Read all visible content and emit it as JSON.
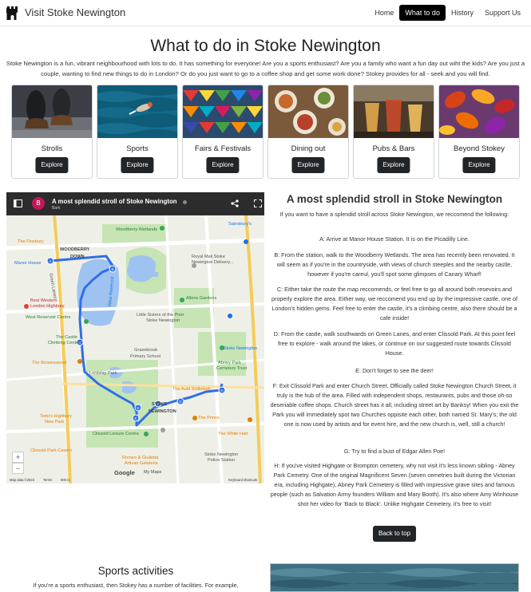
{
  "nav": {
    "brand": "Visit Stoke Newington",
    "links": [
      "Home",
      "What to do",
      "History",
      "Support Us"
    ]
  },
  "header": {
    "title": "What to do in Stoke Newington",
    "intro": "Stoke Newington is a fun, vibrant neighbourhood with lots to do. It has something for everyone! Are you a sports enthusiast? Are you a family who want a fun day out wiht the kids? Are you just a couple, wanting to find new things to do in London? Or do you just want to go to a coffee shop and get some work done? Stokey provides for all - seek and you will find."
  },
  "cards": [
    {
      "title": "Strolls",
      "button": "Explore",
      "image": "boots-walking-photo"
    },
    {
      "title": "Sports",
      "button": "Explore",
      "image": "swimmer-photo"
    },
    {
      "title": "Fairs & Festivals",
      "button": "Explore",
      "image": "bunting-photo"
    },
    {
      "title": "Dining out",
      "button": "Explore",
      "image": "food-table-photo"
    },
    {
      "title": "Pubs & Bars",
      "button": "Explore",
      "image": "cocktails-photo"
    },
    {
      "title": "Beyond Stokey",
      "button": "Explore",
      "image": "autumn-leaves-photo"
    }
  ],
  "map": {
    "avatar": "B",
    "title": "A most splendid stroll of Stoke Newington",
    "subtitle": "Bark",
    "labels": {
      "woodberry_wetlands": "Woodberry Wetlands",
      "sainsburys": "Sainsbury's",
      "woodberry_down_1": "WOODBERRY",
      "woodberry_down_2": "DOWN",
      "royal_mail": "Royal Mail Stoke",
      "royal_mail_2": "Newington Delivery...",
      "manor_house": "Manor House",
      "finsbury": "The Finsbury",
      "west_reservoir": "West Reservoir",
      "best_western_1": "Best Western",
      "best_western_2": "London Highbury",
      "allens_gardens": "Allens Gardens",
      "little_sisters_1": "Little Sisters of the Poor",
      "little_sisters_2": "Stoke Newington",
      "west_reservoir_centre": "West Reservoir Centre",
      "castle_1": "The Castle",
      "castle_2": "Climbing Centre",
      "grazebrook_1": "Grazebrook",
      "grazebrook_2": "Primary School",
      "stoke_newington": "Stoke Newington",
      "abney_1": "Abney Park",
      "abney_2": "Cemetery Trust",
      "brownswood": "The Brownswood",
      "lordship": "Lordship Park",
      "auld_shillelagh": "The Auld Shillelagh",
      "stoke_n_1": "STOKE",
      "stoke_n_2": "NEWINGTON",
      "tettos_1": "Tetto's Highbury",
      "tettos_2": "New Park",
      "prince": "The Prince",
      "white_hart": "The White Hart",
      "clissold_leisure": "Clissold Leisure Centre",
      "clissold_cafe": "Clissold Park Cavern",
      "romeo_1": "Romeo & Giulietta",
      "romeo_2": "Artisan Gelateria",
      "police_1": "Stoke Newington",
      "police_2": "Police Station",
      "green_lanes": "Green Lanes",
      "west_hackney": "West Hackney"
    },
    "markers": [
      "A",
      "B",
      "C",
      "D",
      "E",
      "F",
      "G",
      "H"
    ],
    "footer": {
      "attribution": "Map data ©2023",
      "terms": "Terms",
      "scale": "500 m",
      "shortcuts": "Keyboard shortcuts"
    },
    "google": "Google",
    "mymaps": "My Maps"
  },
  "directions": {
    "title": "A most splendid stroll in Stoke Newington",
    "paragraphs": [
      "If you want to have a splendid stroll across Stoke Newington, we reccomend the following:",
      "A: Arrive at Manor House Station. It is on the Picadilly Line.",
      "B: From the station, walk to the Woodberry Wetlands. The area has recently been renovated. It will seem as if you're in the countryside, with views of church steeples and the nearby castle, however if you're careul, you'll spot some glimpses of Canary Wharf!",
      "C: Either take the route the map reccomends, or feel free to go all around both resevoirs and properly explore the area. Either way, we reccomend you end up by the impressive castle, one of London's hidden gems. Feel free to enter the castle, it's a climbing centre, also there should be a cafe inside!",
      "D: From the castle, walk southwards on Green Lanes, and enter Clissold Park. At this point feel free to explore - walk around the lakes, or continue on our suggested route towards Clissold House.",
      "E: Don't forget to see the deer!",
      "F: Exit Clissold Park and enter Church Street. Officially called Stoke Newington Church Street, it truly is the hub of the area. Filled with independent shops, restaurants, pubs and those oh-so deseriable coffee shops. Church street has it all, including street art by Banksy! When you exit the Park you will immediately spot two Churches oppisite each other, both named St. Mary's; the old one is now used by artists and for event hire, and the new church is, well, still a church!",
      "G: Try to find a bust of Edgar Allen Poe!",
      "H: If you've visited Highgate or Brompton cemetery, why not visit it's less known sibling - Abney Park Cemetry. One of the original Magnificent Seven (seven cemetries built during the Victorian era, including Highgate), Abney Park Cemetery is filled with impressive grave sites and famous people (such as Salvation Army founders William and Mary Booth). It's also where Amy Winhouse shot her video for 'Back to Black'. Unlike Highgate Cemetery, it's free to visit!"
    ],
    "back_to_top": "Back to top"
  },
  "sports": {
    "title": "Sports activities",
    "text": "If you're a sports enthusiast, then Stokey has a number of facilities. For example,"
  }
}
